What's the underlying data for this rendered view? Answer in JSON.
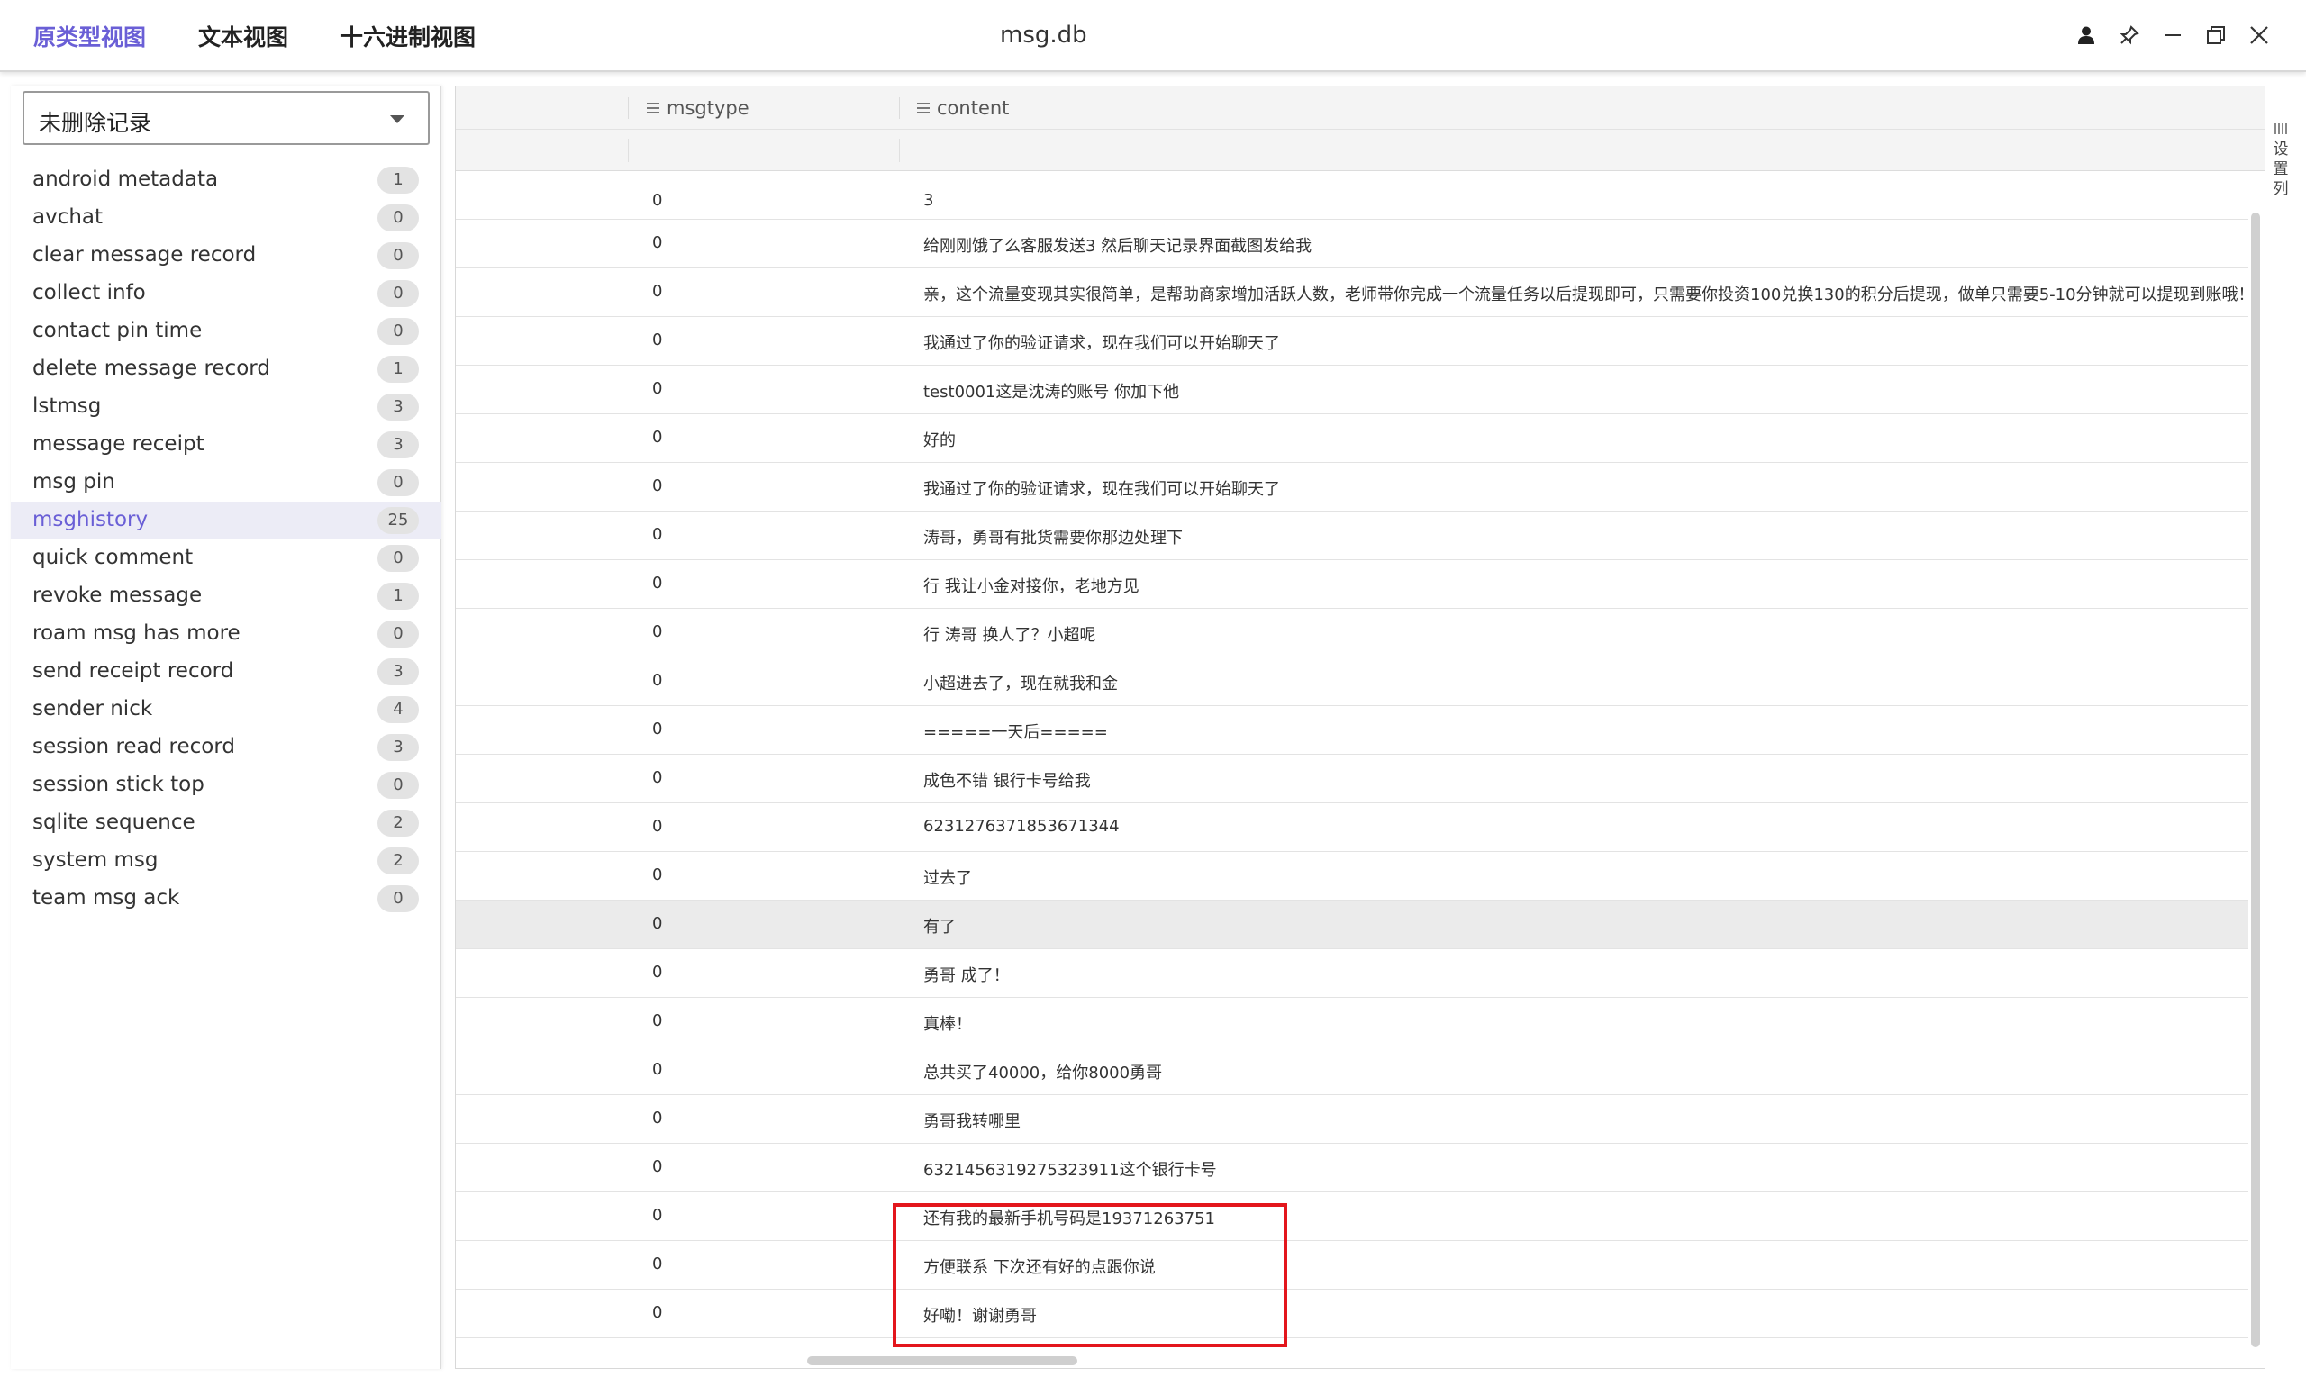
{
  "titlebar": {
    "tabs": [
      "原类型视图",
      "文本视图",
      "十六进制视图"
    ],
    "active_tab": 0,
    "title": "msg.db",
    "icons": [
      "user-icon",
      "pin-icon",
      "minimize-icon",
      "maximize-icon",
      "close-icon"
    ],
    "accent_color": "#6a5fd6"
  },
  "sidebar": {
    "filter_select": "未删除记录",
    "tables": [
      {
        "name": "android metadata",
        "count": "1"
      },
      {
        "name": "avchat",
        "count": "0"
      },
      {
        "name": "clear message record",
        "count": "0"
      },
      {
        "name": "collect info",
        "count": "0"
      },
      {
        "name": "contact pin time",
        "count": "0"
      },
      {
        "name": "delete message record",
        "count": "1"
      },
      {
        "name": "lstmsg",
        "count": "3"
      },
      {
        "name": "message receipt",
        "count": "3"
      },
      {
        "name": "msg pin",
        "count": "0"
      },
      {
        "name": "msghistory",
        "count": "25",
        "active": true
      },
      {
        "name": "quick comment",
        "count": "0"
      },
      {
        "name": "revoke message",
        "count": "1"
      },
      {
        "name": "roam msg has more",
        "count": "0"
      },
      {
        "name": "send receipt record",
        "count": "3"
      },
      {
        "name": "sender nick",
        "count": "4"
      },
      {
        "name": "session read record",
        "count": "3"
      },
      {
        "name": "session stick top",
        "count": "0"
      },
      {
        "name": "sqlite sequence",
        "count": "2"
      },
      {
        "name": "system msg",
        "count": "2"
      },
      {
        "name": "team msg ack",
        "count": "0"
      }
    ]
  },
  "grid": {
    "columns": [
      "msgtype",
      "content"
    ],
    "column_settings_label": "设置列",
    "rows": [
      {
        "msgtype": "0",
        "content": "3"
      },
      {
        "msgtype": "0",
        "content": "给刚刚饿了么客服发送3 然后聊天记录界面截图发给我"
      },
      {
        "msgtype": "0",
        "content": "亲，这个流量变现其实很简单，是帮助商家增加活跃人数，老师带你完成一个流量任务以后提现即可，只需要你投资100兑换130的积分后提现，做单只需要5-10分钟就可以提现到账哦！"
      },
      {
        "msgtype": "0",
        "content": "我通过了你的验证请求，现在我们可以开始聊天了"
      },
      {
        "msgtype": "0",
        "content": "test0001这是沈涛的账号 你加下他"
      },
      {
        "msgtype": "0",
        "content": "好的"
      },
      {
        "msgtype": "0",
        "content": "我通过了你的验证请求，现在我们可以开始聊天了"
      },
      {
        "msgtype": "0",
        "content": "涛哥，勇哥有批货需要你那边处理下"
      },
      {
        "msgtype": "0",
        "content": "行 我让小金对接你，老地方见"
      },
      {
        "msgtype": "0",
        "content": "行 涛哥 换人了？小超呢"
      },
      {
        "msgtype": "0",
        "content": "小超进去了，现在就我和金"
      },
      {
        "msgtype": "0",
        "content": "=====一天后====="
      },
      {
        "msgtype": "0",
        "content": "成色不错 银行卡号给我"
      },
      {
        "msgtype": "0",
        "content": "6231276371853671344"
      },
      {
        "msgtype": "0",
        "content": "过去了"
      },
      {
        "msgtype": "0",
        "content": "有了",
        "highlighted": true
      },
      {
        "msgtype": "0",
        "content": "勇哥 成了！"
      },
      {
        "msgtype": "0",
        "content": "真棒！"
      },
      {
        "msgtype": "0",
        "content": "总共买了40000，给你8000勇哥"
      },
      {
        "msgtype": "0",
        "content": "勇哥我转哪里"
      },
      {
        "msgtype": "0",
        "content": "6321456319275323911这个银行卡号"
      },
      {
        "msgtype": "0",
        "content": "还有我的最新手机号码是19371263751"
      },
      {
        "msgtype": "0",
        "content": "方便联系 下次还有好的点跟你说"
      },
      {
        "msgtype": "0",
        "content": "好嘞！谢谢勇哥"
      }
    ],
    "annotation_color": "#e3161c"
  }
}
